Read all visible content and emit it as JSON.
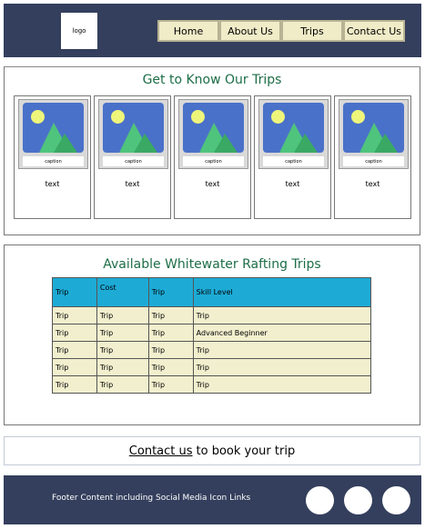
{
  "header": {
    "logo": "logo",
    "nav": [
      "Home",
      "About Us",
      "Trips",
      "Contact Us"
    ]
  },
  "trips_section": {
    "title": "Get to Know Our Trips",
    "cards": [
      {
        "caption": "caption",
        "text": "text"
      },
      {
        "caption": "caption",
        "text": "text"
      },
      {
        "caption": "caption",
        "text": "text"
      },
      {
        "caption": "caption",
        "text": "text"
      },
      {
        "caption": "caption",
        "text": "text"
      }
    ]
  },
  "table_section": {
    "title": "Available Whitewater Rafting Trips",
    "headers": [
      "Trip",
      "Cost",
      "Trip",
      "Skill Level"
    ],
    "rows": [
      [
        "Trip",
        "Trip",
        "Trip",
        "Trip"
      ],
      [
        "Trip",
        "Trip",
        "Trip",
        "Advanced Beginner"
      ],
      [
        "Trip",
        "Trip",
        "Trip",
        "Trip"
      ],
      [
        "Trip",
        "Trip",
        "Trip",
        "Trip"
      ],
      [
        "Trip",
        "Trip",
        "Trip",
        "Trip"
      ]
    ]
  },
  "contact": {
    "link": "Contact us",
    "rest": "to book your trip"
  },
  "footer": {
    "text": "Footer Content including Social Media Icon Links",
    "social_icons": [
      "social-icon",
      "social-icon",
      "social-icon"
    ]
  },
  "colors": {
    "header_bg": "#343f5d",
    "nav_bg": "#f0ecc8",
    "title_green": "#1d6e47",
    "table_header": "#1dabd6",
    "table_row": "#f2efce"
  }
}
